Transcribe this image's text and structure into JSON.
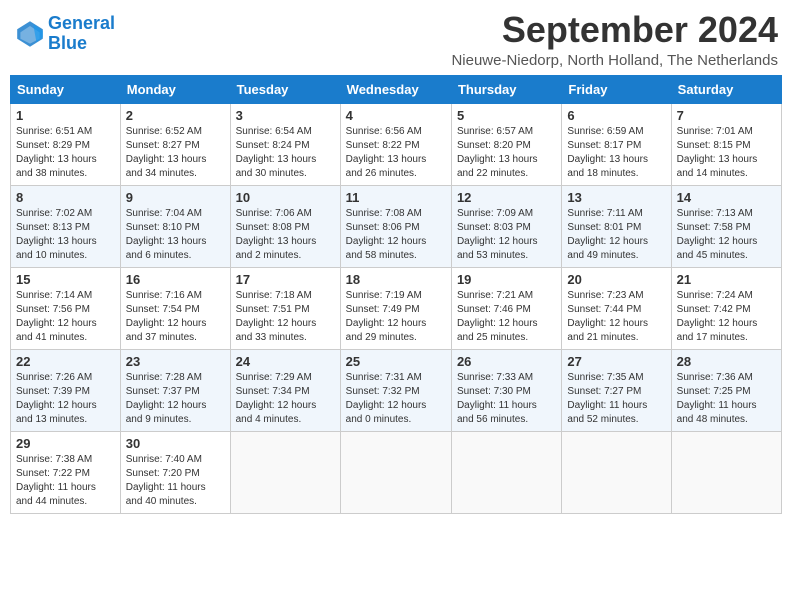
{
  "header": {
    "logo_line1": "General",
    "logo_line2": "Blue",
    "title": "September 2024",
    "subtitle": "Nieuwe-Niedorp, North Holland, The Netherlands"
  },
  "columns": [
    "Sunday",
    "Monday",
    "Tuesday",
    "Wednesday",
    "Thursday",
    "Friday",
    "Saturday"
  ],
  "weeks": [
    [
      {
        "day": "1",
        "info": "Sunrise: 6:51 AM\nSunset: 8:29 PM\nDaylight: 13 hours\nand 38 minutes."
      },
      {
        "day": "2",
        "info": "Sunrise: 6:52 AM\nSunset: 8:27 PM\nDaylight: 13 hours\nand 34 minutes."
      },
      {
        "day": "3",
        "info": "Sunrise: 6:54 AM\nSunset: 8:24 PM\nDaylight: 13 hours\nand 30 minutes."
      },
      {
        "day": "4",
        "info": "Sunrise: 6:56 AM\nSunset: 8:22 PM\nDaylight: 13 hours\nand 26 minutes."
      },
      {
        "day": "5",
        "info": "Sunrise: 6:57 AM\nSunset: 8:20 PM\nDaylight: 13 hours\nand 22 minutes."
      },
      {
        "day": "6",
        "info": "Sunrise: 6:59 AM\nSunset: 8:17 PM\nDaylight: 13 hours\nand 18 minutes."
      },
      {
        "day": "7",
        "info": "Sunrise: 7:01 AM\nSunset: 8:15 PM\nDaylight: 13 hours\nand 14 minutes."
      }
    ],
    [
      {
        "day": "8",
        "info": "Sunrise: 7:02 AM\nSunset: 8:13 PM\nDaylight: 13 hours\nand 10 minutes."
      },
      {
        "day": "9",
        "info": "Sunrise: 7:04 AM\nSunset: 8:10 PM\nDaylight: 13 hours\nand 6 minutes."
      },
      {
        "day": "10",
        "info": "Sunrise: 7:06 AM\nSunset: 8:08 PM\nDaylight: 13 hours\nand 2 minutes."
      },
      {
        "day": "11",
        "info": "Sunrise: 7:08 AM\nSunset: 8:06 PM\nDaylight: 12 hours\nand 58 minutes."
      },
      {
        "day": "12",
        "info": "Sunrise: 7:09 AM\nSunset: 8:03 PM\nDaylight: 12 hours\nand 53 minutes."
      },
      {
        "day": "13",
        "info": "Sunrise: 7:11 AM\nSunset: 8:01 PM\nDaylight: 12 hours\nand 49 minutes."
      },
      {
        "day": "14",
        "info": "Sunrise: 7:13 AM\nSunset: 7:58 PM\nDaylight: 12 hours\nand 45 minutes."
      }
    ],
    [
      {
        "day": "15",
        "info": "Sunrise: 7:14 AM\nSunset: 7:56 PM\nDaylight: 12 hours\nand 41 minutes."
      },
      {
        "day": "16",
        "info": "Sunrise: 7:16 AM\nSunset: 7:54 PM\nDaylight: 12 hours\nand 37 minutes."
      },
      {
        "day": "17",
        "info": "Sunrise: 7:18 AM\nSunset: 7:51 PM\nDaylight: 12 hours\nand 33 minutes."
      },
      {
        "day": "18",
        "info": "Sunrise: 7:19 AM\nSunset: 7:49 PM\nDaylight: 12 hours\nand 29 minutes."
      },
      {
        "day": "19",
        "info": "Sunrise: 7:21 AM\nSunset: 7:46 PM\nDaylight: 12 hours\nand 25 minutes."
      },
      {
        "day": "20",
        "info": "Sunrise: 7:23 AM\nSunset: 7:44 PM\nDaylight: 12 hours\nand 21 minutes."
      },
      {
        "day": "21",
        "info": "Sunrise: 7:24 AM\nSunset: 7:42 PM\nDaylight: 12 hours\nand 17 minutes."
      }
    ],
    [
      {
        "day": "22",
        "info": "Sunrise: 7:26 AM\nSunset: 7:39 PM\nDaylight: 12 hours\nand 13 minutes."
      },
      {
        "day": "23",
        "info": "Sunrise: 7:28 AM\nSunset: 7:37 PM\nDaylight: 12 hours\nand 9 minutes."
      },
      {
        "day": "24",
        "info": "Sunrise: 7:29 AM\nSunset: 7:34 PM\nDaylight: 12 hours\nand 4 minutes."
      },
      {
        "day": "25",
        "info": "Sunrise: 7:31 AM\nSunset: 7:32 PM\nDaylight: 12 hours\nand 0 minutes."
      },
      {
        "day": "26",
        "info": "Sunrise: 7:33 AM\nSunset: 7:30 PM\nDaylight: 11 hours\nand 56 minutes."
      },
      {
        "day": "27",
        "info": "Sunrise: 7:35 AM\nSunset: 7:27 PM\nDaylight: 11 hours\nand 52 minutes."
      },
      {
        "day": "28",
        "info": "Sunrise: 7:36 AM\nSunset: 7:25 PM\nDaylight: 11 hours\nand 48 minutes."
      }
    ],
    [
      {
        "day": "29",
        "info": "Sunrise: 7:38 AM\nSunset: 7:22 PM\nDaylight: 11 hours\nand 44 minutes."
      },
      {
        "day": "30",
        "info": "Sunrise: 7:40 AM\nSunset: 7:20 PM\nDaylight: 11 hours\nand 40 minutes."
      },
      null,
      null,
      null,
      null,
      null
    ]
  ]
}
